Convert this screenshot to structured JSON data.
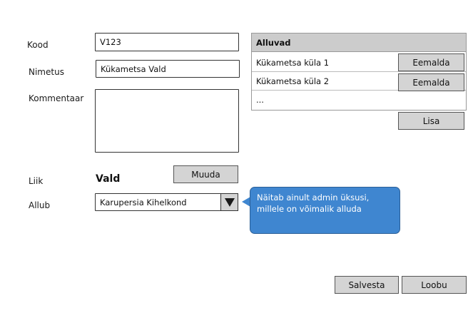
{
  "form": {
    "kood_label": "Kood",
    "kood_value": "V123",
    "nimetus_label": "Nimetus",
    "nimetus_value": "Kükametsa Vald",
    "kommentaar_label": "Kommentaar",
    "kommentaar_value": "",
    "liik_label": "Liik",
    "liik_value": "Vald",
    "muuda_label": "Muuda",
    "allub_label": "Allub",
    "allub_value": "Karupersia Kihelkond"
  },
  "subordinates": {
    "header": "Alluvad",
    "items": [
      {
        "name": "Kükametsa küla 1",
        "remove_label": "Eemalda"
      },
      {
        "name": "Kükametsa küla 2",
        "remove_label": "Eemalda"
      }
    ],
    "more": "...",
    "add_label": "Lisa"
  },
  "callout": {
    "text": "Näitab ainult admin üksusi, millele on võimalik alluda"
  },
  "footer": {
    "save_label": "Salvesta",
    "cancel_label": "Loobu"
  },
  "icons": {
    "dropdown": "triangle-down-icon"
  },
  "colors": {
    "button_bg": "#d4d4d4",
    "callout_bg": "#3f86d0",
    "panel_header_bg": "#cccccc"
  }
}
